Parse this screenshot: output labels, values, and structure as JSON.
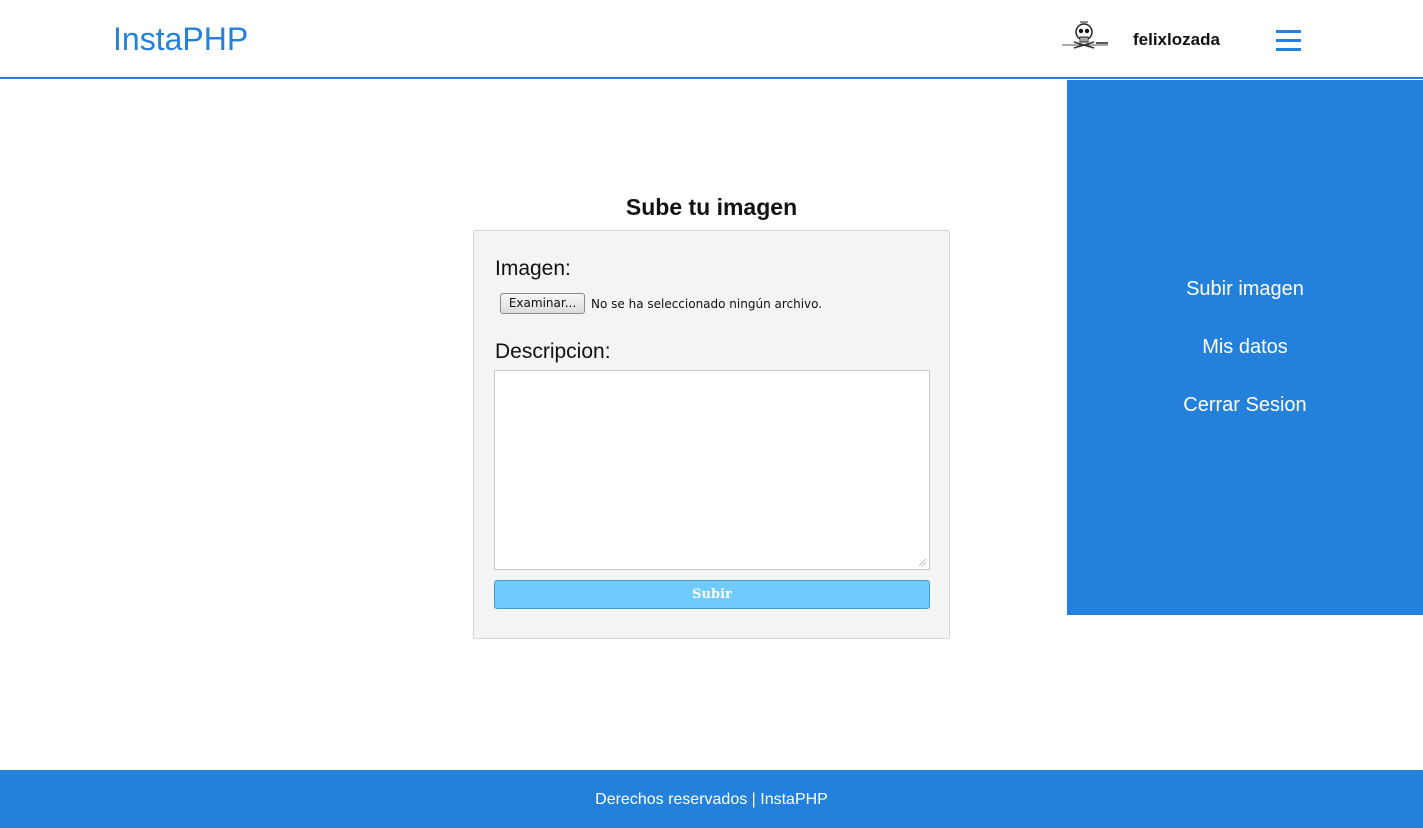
{
  "header": {
    "logo": "InstaPHP",
    "username": "felixlozada",
    "avatar_icon": "skull-avatar-icon",
    "menu_icon": "hamburger-menu-icon"
  },
  "side_menu": {
    "items": [
      {
        "label": "Subir imagen"
      },
      {
        "label": "Mis datos"
      },
      {
        "label": "Cerrar Sesion"
      }
    ]
  },
  "form": {
    "title": "Sube tu imagen",
    "image_label": "Imagen:",
    "file_button": "Examinar...",
    "file_status": "No se ha seleccionado ningún archivo.",
    "description_label": "Descripcion:",
    "description_value": "",
    "submit_label": "Subir"
  },
  "footer": {
    "text": "Derechos reservados | InstaPHP"
  },
  "colors": {
    "accent": "#2381dc",
    "submit": "#70cbfc",
    "card_bg": "#f4f4f4"
  }
}
